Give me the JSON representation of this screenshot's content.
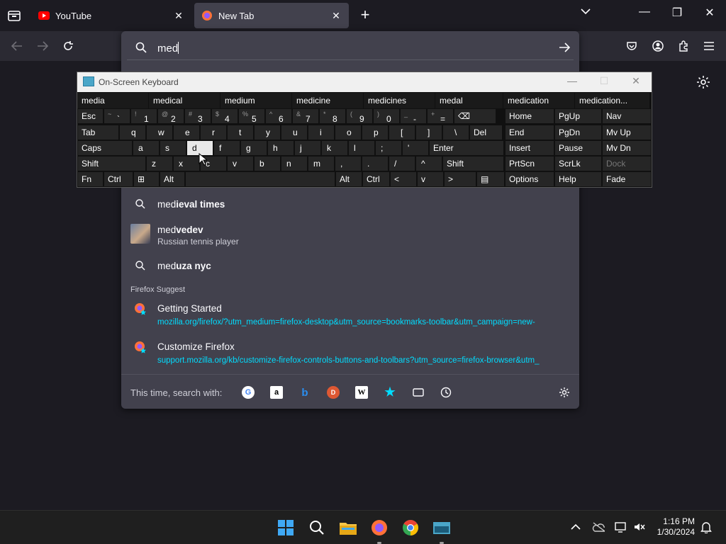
{
  "tabs": [
    {
      "label": "YouTube",
      "active": false,
      "favicon": "youtube-icon"
    },
    {
      "label": "New Tab",
      "active": true,
      "favicon": "firefox-icon"
    }
  ],
  "urlbar": {
    "value": "med",
    "suggestions": [
      {
        "prefix": "med",
        "bold": "ieval times",
        "type": "search"
      },
      {
        "prefix": "med",
        "bold": "vedev",
        "sub": "Russian tennis player",
        "type": "entity"
      },
      {
        "prefix": "med",
        "bold": "uza nyc",
        "type": "search"
      }
    ],
    "section_header": "Firefox Suggest",
    "firefox_suggest": [
      {
        "title": "Getting Started",
        "url": "mozilla.org/firefox/?utm_medium=firefox-desktop&utm_source=bookmarks-toolbar&utm_campaign=new-"
      },
      {
        "title": "Customize Firefox",
        "url": "support.mozilla.org/kb/customize-firefox-controls-buttons-and-toolbars?utm_source=firefox-browser&utm_"
      }
    ],
    "search_with_label": "This time, search with:",
    "engines": [
      "google-icon",
      "amazon-icon",
      "bing-icon",
      "duckduckgo-icon",
      "wikipedia-icon",
      "bookmarks-star-icon",
      "tabs-icon",
      "history-clock-icon"
    ]
  },
  "osk": {
    "title": "On-Screen Keyboard",
    "predictions": [
      "media",
      "medical",
      "medium",
      "medicine",
      "medicines",
      "medal",
      "medication",
      "medication..."
    ],
    "row1": [
      {
        "m": "Esc"
      },
      {
        "s": "~",
        "l": "`"
      },
      {
        "s": "!",
        "l": "1"
      },
      {
        "s": "@",
        "l": "2"
      },
      {
        "s": "#",
        "l": "3"
      },
      {
        "s": "$",
        "l": "4"
      },
      {
        "s": "%",
        "l": "5"
      },
      {
        "s": "^",
        "l": "6"
      },
      {
        "s": "&",
        "l": "7"
      },
      {
        "s": "*",
        "l": "8"
      },
      {
        "s": "(",
        "l": "9"
      },
      {
        "s": ")",
        "l": "0"
      },
      {
        "s": "_",
        "l": "-"
      },
      {
        "s": "+",
        "l": "="
      },
      {
        "m": "⌫"
      }
    ],
    "row2": [
      "Tab",
      "q",
      "w",
      "e",
      "r",
      "t",
      "y",
      "u",
      "i",
      "o",
      "p",
      "[",
      "]",
      "\\",
      "Del"
    ],
    "row3": [
      "Caps",
      "a",
      "s",
      "d",
      "f",
      "g",
      "h",
      "j",
      "k",
      "l",
      ";",
      "'",
      "Enter"
    ],
    "row4": [
      "Shift",
      "z",
      "x",
      "c",
      "v",
      "b",
      "n",
      "m",
      ",",
      ".",
      "/",
      "^",
      "Shift"
    ],
    "row5": [
      "Fn",
      "Ctrl",
      "⊞",
      "Alt",
      "",
      "Alt",
      "Ctrl",
      "<",
      "v",
      ">",
      "▤"
    ],
    "nav": [
      [
        "Home",
        "PgUp",
        "Nav"
      ],
      [
        "End",
        "PgDn",
        "Mv Up"
      ],
      [
        "Insert",
        "Pause",
        "Mv Dn"
      ],
      [
        "PrtScn",
        "ScrLk",
        "Dock"
      ],
      [
        "Options",
        "Help",
        "Fade"
      ]
    ]
  },
  "clock": {
    "time": "1:16 PM",
    "date": "1/30/2024"
  }
}
